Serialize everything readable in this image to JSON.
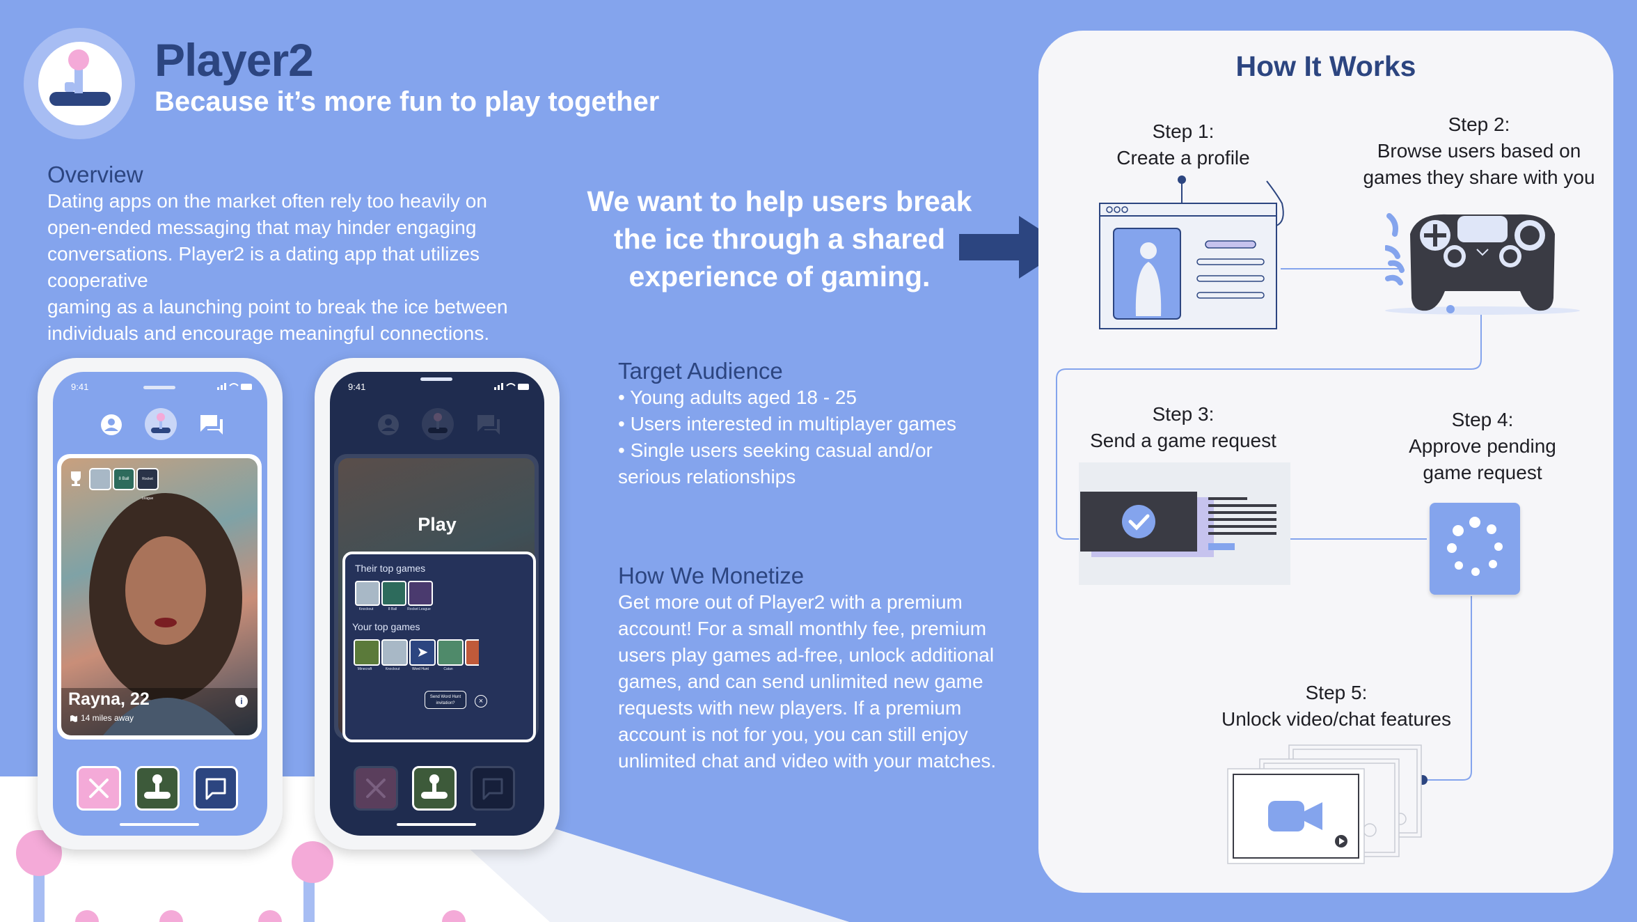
{
  "brand": {
    "name": "Player2",
    "tagline": "Because it’s more fun to play together"
  },
  "overview": {
    "heading": "Overview",
    "lines": [
      "Dating apps on the market often rely too heavily on",
      "open-ended messaging that may hinder engaging",
      "conversations. Player2 is a dating app that utilizes cooperative",
      "gaming as a launching point to break the ice between",
      "individuals and encourage meaningful connections."
    ]
  },
  "pitch": {
    "lines": [
      "We want to help users break",
      "the ice through a shared",
      "experience of gaming."
    ]
  },
  "audience": {
    "heading": "Target Audience",
    "items": [
      "• Young adults aged 18 - 25",
      "• Users interested in multiplayer games",
      "• Single users seeking casual and/or",
      "serious relationships"
    ]
  },
  "monetize": {
    "heading": "How We Monetize",
    "lines": [
      "Get more out of Player2 with a premium",
      "account! For a small monthly fee, premium",
      "users play games ad-free, unlock additional",
      "games, and can send unlimited new game",
      "requests with new players. If a premium",
      "account is not for you, you can still enjoy",
      "unlimited chat and video with your matches."
    ]
  },
  "phone1": {
    "time": "9:41",
    "profile_name": "Rayna, 22",
    "distance": "14 miles away",
    "game_tiles": [
      "",
      "",
      "8 Ball",
      "Rocket League"
    ]
  },
  "phone2": {
    "time": "9:41",
    "play_title": "Play",
    "their_heading": "Their top games",
    "their_games": [
      "Knockout",
      "8 Ball",
      "Rocket League"
    ],
    "your_heading": "Your top games",
    "your_games": [
      "Minecraft",
      "Knockout",
      "Word Hunt",
      "Catan"
    ],
    "invite_label": "Send Word Hunt invitation?"
  },
  "how_it_works": {
    "title": "How It Works",
    "step1": {
      "label": "Step 1:",
      "text": "Create a profile"
    },
    "step2": {
      "label": "Step 2:",
      "line1": "Browse users based on",
      "line2": "games they share with you"
    },
    "step3": {
      "label": "Step 3:",
      "text": "Send a game request"
    },
    "step4": {
      "label": "Step 4:",
      "line1": "Approve pending",
      "line2": "game request"
    },
    "step5": {
      "label": "Step 5:",
      "text": "Unlock video/chat features"
    }
  },
  "colors": {
    "background": "#84a4ed",
    "navy": "#2c4580",
    "pink": "#f4aad8",
    "card": "#f6f6f9",
    "dark_screen": "#1f2c4f"
  }
}
